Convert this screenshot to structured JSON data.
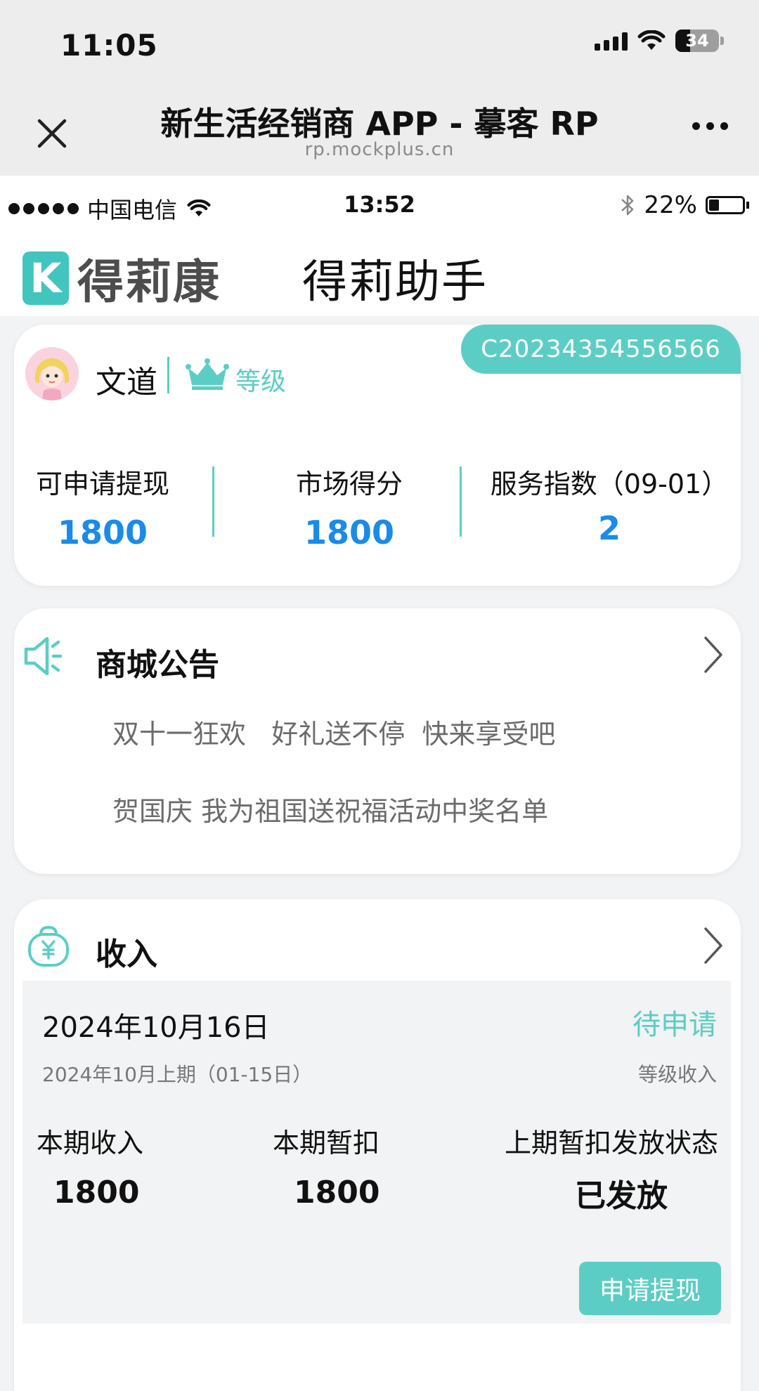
{
  "os_status": {
    "time": "11:05",
    "battery": "34"
  },
  "browser": {
    "title": "新生活经销商 APP - 摹客 RP",
    "url": "rp.mockplus.cn"
  },
  "inner_status": {
    "carrier": "中国电信",
    "time": "13:52",
    "battery": "22%"
  },
  "header": {
    "logo_text": "得莉康",
    "logo_mark": "K",
    "title": "得莉助手"
  },
  "user": {
    "member_code": "C20234354556566",
    "name": "文道",
    "level_label": "等级",
    "stats": [
      {
        "label": "可申请提现",
        "value": "1800"
      },
      {
        "label": "市场得分",
        "value": "1800"
      },
      {
        "label": "服务指数（09-01）",
        "value": "2"
      }
    ]
  },
  "notice": {
    "title": "商城公告",
    "items": [
      "双十一狂欢   好礼送不停  快来享受吧",
      "贺国庆 我为祖国送祝福活动中奖名单"
    ]
  },
  "income": {
    "title": "收入",
    "date": "2024年10月16日",
    "status": "待申请",
    "period": "2024年10月上期（01-15日）",
    "type": "等级收入",
    "current_income_label": "本期收入",
    "current_income": "1800",
    "withheld_label": "本期暂扣",
    "withheld": "1800",
    "prev_status_label": "上期暂扣发放状态",
    "prev_status": "已发放",
    "withdraw_button": "申请提现"
  },
  "colors": {
    "accent": "#5ccdc5",
    "value_blue": "#1a8be8"
  }
}
